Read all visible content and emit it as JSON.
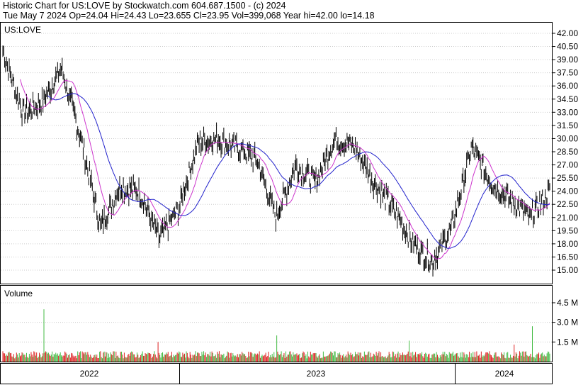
{
  "header": {
    "line1": "Historic Chart for US:LOVE by Stockwatch.com 604.687.1500 - (c) 2024",
    "line2": "Tue May  7 2024  Op=24.04  Hi=24.43  Lo=23.655  Cl=23.95  Vol=399,068  Year hi=42.00  lo=14.18"
  },
  "colors": {
    "price_bar": "#000000",
    "ma_short": "#cc33cc",
    "ma_long": "#2222cc",
    "vol_up": "#44bb44",
    "vol_down": "#dd2222",
    "grid": "#cccccc"
  },
  "chart_data": [
    {
      "type": "line",
      "label": "US:LOVE",
      "x_labels": [
        "2022",
        "2023",
        "2024"
      ],
      "y_ticks": [
        "15.00",
        "16.50",
        "18.00",
        "19.50",
        "21.00",
        "22.50",
        "24.00",
        "25.50",
        "27.00",
        "28.50",
        "30.00",
        "31.50",
        "33.00",
        "34.50",
        "36.00",
        "37.50",
        "39.00",
        "40.50",
        "42.00"
      ],
      "ylim": [
        14.18,
        42.0
      ],
      "series": [
        {
          "name": "",
          "x": [
            "2022-01",
            "2022-02",
            "2022-03",
            "2022-04",
            "2022-05",
            "2022-06",
            "2022-07",
            "2022-08",
            "2022-09",
            "2022-10",
            "2022-11",
            "2022-12",
            "2023-01",
            "2023-02",
            "2023-03",
            "2023-04",
            "2023-05",
            "2023-06",
            "2023-07",
            "2023-08",
            "2023-09",
            "2023-10",
            "2023-11",
            "2023-12",
            "2024-01",
            "2024-02",
            "2024-03",
            "2024-04",
            "2024-05"
          ],
          "values": [
            40.0,
            33.0,
            34.0,
            38.0,
            30.0,
            20.0,
            24.5,
            24.0,
            18.5,
            22.0,
            29.5,
            30.0,
            29.0,
            27.5,
            21.0,
            27.0,
            25.0,
            30.0,
            29.0,
            25.0,
            22.0,
            18.0,
            16.0,
            20.0,
            29.0,
            25.0,
            23.0,
            21.0,
            23.95
          ]
        },
        {
          "name": "",
          "values": []
        },
        {
          "name": "",
          "values": []
        }
      ]
    },
    {
      "type": "bar",
      "label": "Volume",
      "y_ticks": [
        "1.5 M",
        "3.0 M",
        "4.5 M"
      ],
      "ylim": [
        0,
        5.8
      ],
      "spikes_millions": [
        4.0,
        1.5,
        2.0,
        1.6,
        1.3,
        2.7
      ]
    }
  ]
}
